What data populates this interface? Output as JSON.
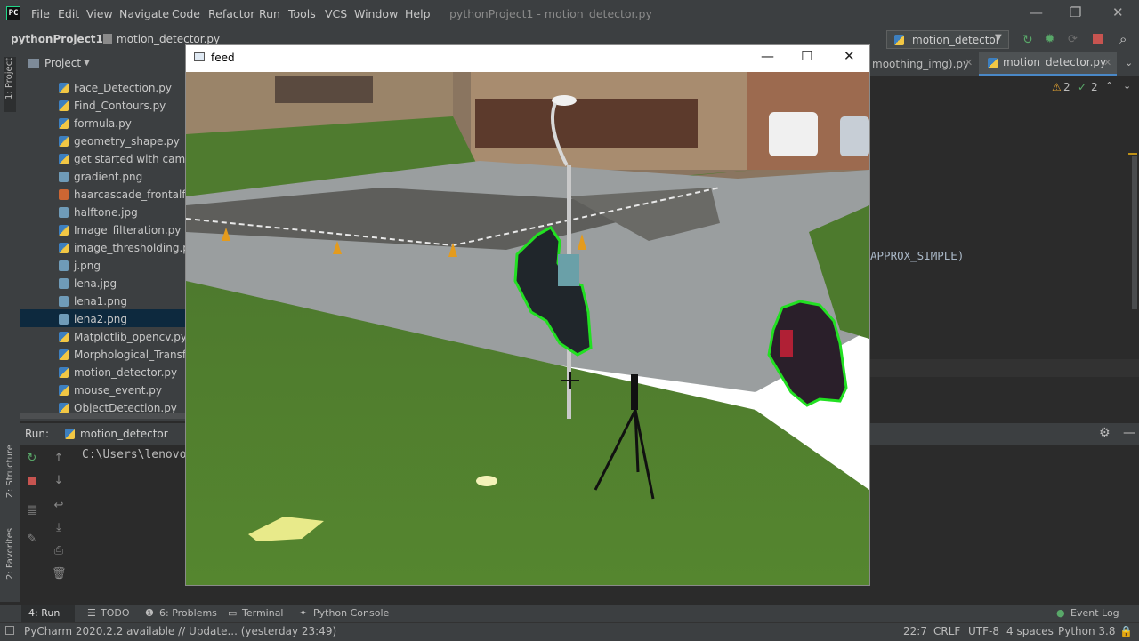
{
  "menubar": {
    "items": [
      "File",
      "Edit",
      "View",
      "Navigate",
      "Code",
      "Refactor",
      "Run",
      "Tools",
      "VCS",
      "Window",
      "Help"
    ],
    "window_title": "pythonProject1 - motion_detector.py",
    "minimize": "—",
    "restore": "❐",
    "close": "✕"
  },
  "navbar": {
    "project": "pythonProject1",
    "file": "motion_detector.py",
    "run_config": "motion_detector"
  },
  "leftstrip": {
    "project_label": "1: Project",
    "structure_label": "Z: Structure",
    "favorites_label": "2: Favorites"
  },
  "project_panel": {
    "title": "Project",
    "items": [
      {
        "name": "Face_Detection.py",
        "type": "py"
      },
      {
        "name": "Find_Contours.py",
        "type": "py"
      },
      {
        "name": "formula.py",
        "type": "py"
      },
      {
        "name": "geometry_shape.py",
        "type": "py"
      },
      {
        "name": "get started with camera",
        "type": "py"
      },
      {
        "name": "gradient.png",
        "type": "img"
      },
      {
        "name": "haarcascade_frontalface",
        "type": "xml"
      },
      {
        "name": "halftone.jpg",
        "type": "img"
      },
      {
        "name": "Image_filteration.py",
        "type": "py"
      },
      {
        "name": "image_thresholding.py",
        "type": "py"
      },
      {
        "name": "j.png",
        "type": "img"
      },
      {
        "name": "lena.jpg",
        "type": "img"
      },
      {
        "name": "lena1.png",
        "type": "img"
      },
      {
        "name": "lena2.png",
        "type": "img"
      },
      {
        "name": "Matplotlib_opencv.py",
        "type": "py"
      },
      {
        "name": "Morphological_Transfor",
        "type": "py"
      },
      {
        "name": "motion_detector.py",
        "type": "py"
      },
      {
        "name": "mouse_event.py",
        "type": "py"
      },
      {
        "name": "ObjectDetection.py",
        "type": "py"
      }
    ],
    "selected_index": 13
  },
  "editor": {
    "tabs": [
      "moothing_img).py",
      "motion_detector.py"
    ],
    "warnings": "2",
    "ok_count": "2",
    "visible_code": "APPROX_SIMPLE)"
  },
  "run_panel": {
    "label": "Run:",
    "config": "motion_detector",
    "console_line": "C:\\Users\\lenovo"
  },
  "feed_window": {
    "title": "feed",
    "minimize": "—",
    "maximize": "☐",
    "close": "✕"
  },
  "bottom_tabs": {
    "run": "4: Run",
    "todo": "TODO",
    "problems": "6: Problems",
    "terminal": "Terminal",
    "python_console": "Python Console",
    "event_log": "Event Log"
  },
  "statusbar": {
    "message": "PyCharm 2020.2.2 available // Update... (yesterday 23:49)",
    "position": "22:7",
    "line_sep": "CRLF",
    "encoding": "UTF-8",
    "indent": "4 spaces",
    "interpreter": "Python 3.8"
  },
  "colors": {
    "ide_bg": "#2b2b2b",
    "panel_bg": "#3c3f41",
    "selection": "#0d293e",
    "contour": "#22e022"
  }
}
